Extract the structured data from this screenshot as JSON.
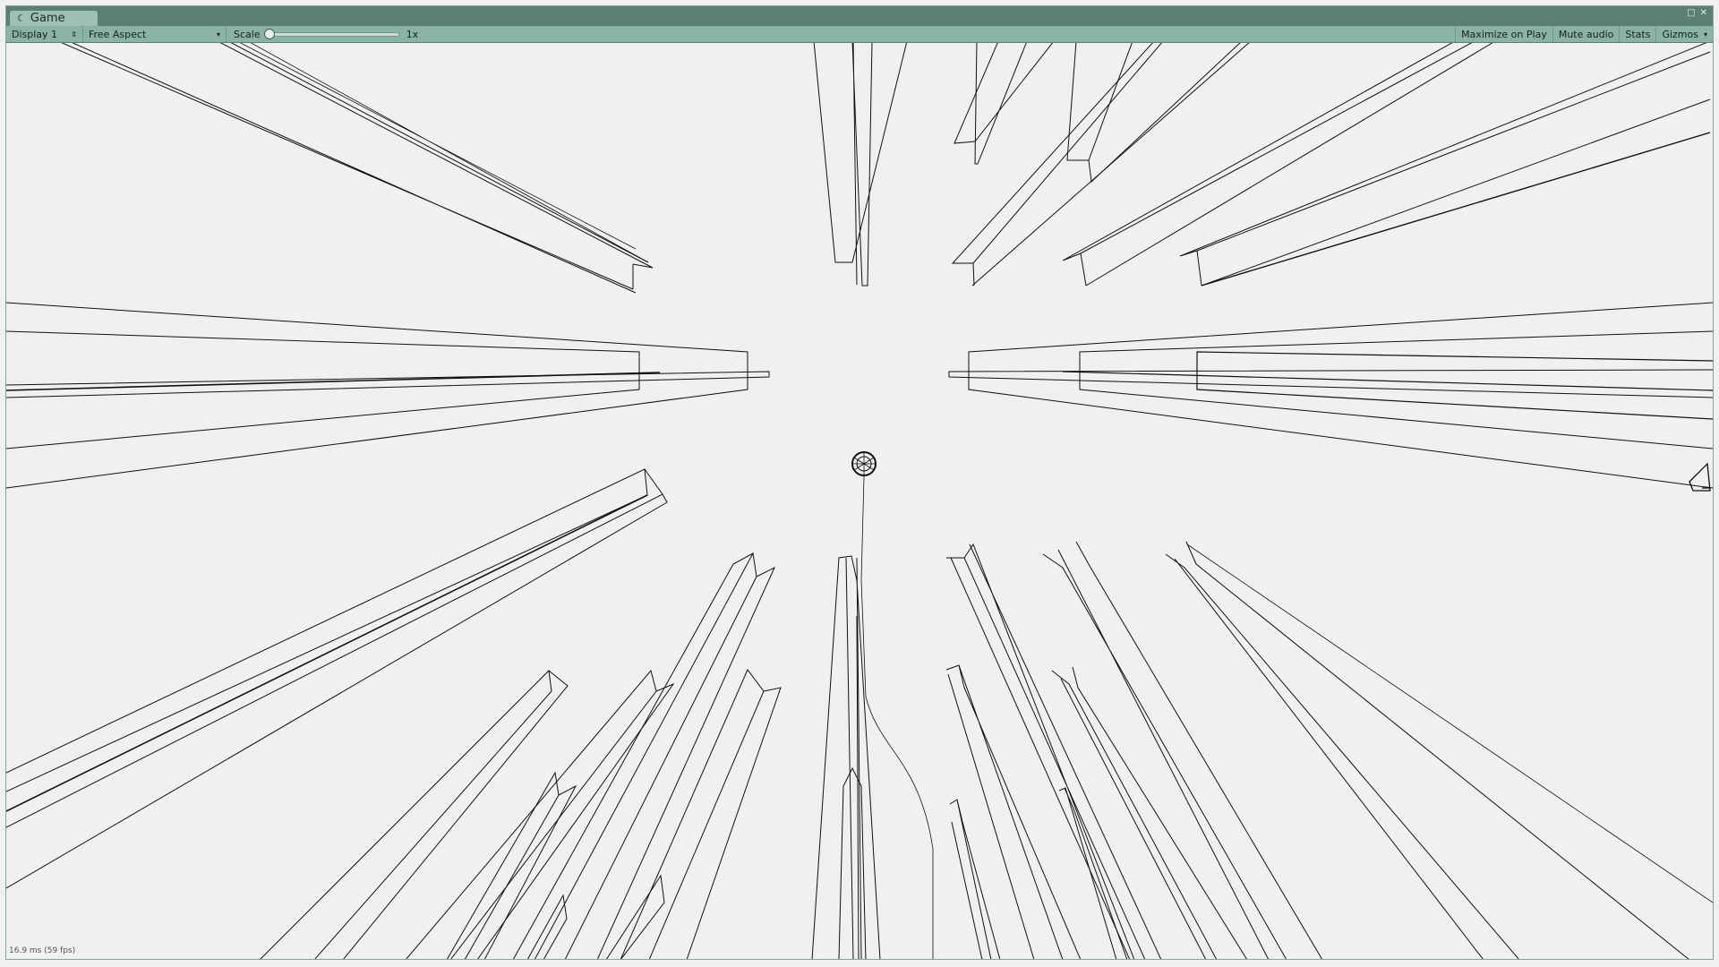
{
  "window": {
    "tab_title": "Game",
    "tab_icon": "unity-game-icon",
    "controls": [
      "□",
      "✕"
    ]
  },
  "toolbar": {
    "display_label": "Display 1",
    "aspect_label": "Free Aspect",
    "scale_label": "Scale",
    "scale_value": "1x",
    "scale_position": 0.0,
    "maximize_label": "Maximize on Play",
    "mute_label": "Mute audio",
    "stats_label": "Stats",
    "gizmos_label": "Gizmos"
  },
  "viewport": {
    "fps_text": "16.9 ms (59 fps)",
    "background_color": "#f0f0f0",
    "line_color": "#111111"
  },
  "colors": {
    "titlebar": "#5b7f72",
    "tab": "#9ec0b3",
    "toolbar": "#8ab3a4"
  }
}
